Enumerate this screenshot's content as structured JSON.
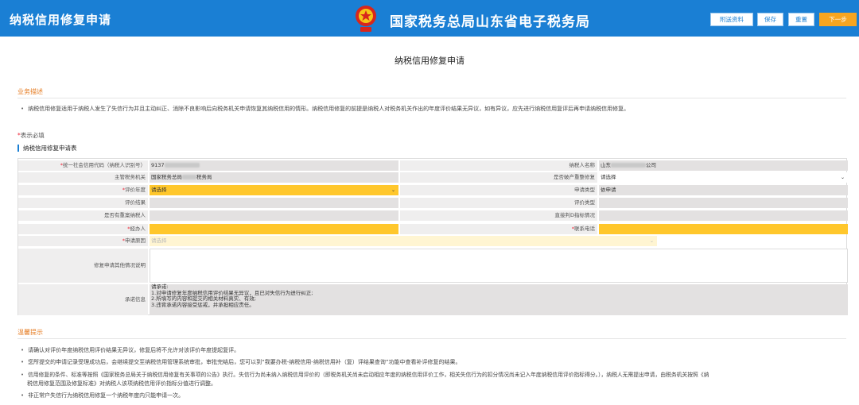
{
  "header": {
    "app_title": "纳税信用修复申请",
    "bureau_name": "国家税务总局山东省电子税务局",
    "buttons": {
      "attachments": "附送资料",
      "save": "保存",
      "reset": "重置",
      "next": "下一步"
    }
  },
  "page_title": "纳税信用修复申请",
  "business_description": {
    "title": "业务描述",
    "text": "纳税信用修复适用于纳税人发生了失信行为并且主动纠正、消除不良影响后向税务机关申请恢复其纳税信用的情形。纳税信用修复的前提是纳税人对税务机关作出的年度评价结果无异议，如有异议，应先进行纳税信用复评后再申请纳税信用修复。"
  },
  "required_note": "表示必填",
  "form": {
    "title": "纳税信用修复申请表",
    "credit_code_label": "统一社会信用代码（纳税人识别号）",
    "credit_code_value": "9137",
    "taxpayer_name_label": "纳税人名称",
    "taxpayer_name_prefix": "山东",
    "taxpayer_name_suffix": "公司",
    "tax_authority_label": "主管税务机关",
    "tax_authority_prefix": "国家税务总局",
    "tax_authority_suffix": "税务局",
    "bankruptcy_label": "是否破产重整修复",
    "bankruptcy_value": "请选择",
    "eval_year_label": "评价年度",
    "eval_year_value": "请选择",
    "apply_type_label": "申请类型",
    "apply_type_value": "依申请",
    "eval_result_label": "评价结果",
    "eval_type_label": "评价类型",
    "major_violation_label": "是否有重案纳税人",
    "direct_d_label": "直接判D指标情况",
    "handler_label": "经办人",
    "contact_phone_label": "联系电话",
    "reason_label": "申请原因",
    "reason_value": "请选择",
    "other_explain_label": "修复申请其他情况说明",
    "promise_label": "承诺信息",
    "promise_text": "请承诺:\n1.对申请修复年度纳税信用评价结果无异议，且已对失信行为进行纠正;\n2.所填写的内容和提交的相关材料真实、有效;\n3.违背承诺内容接受惩戒，并承担相应责任。"
  },
  "tips": {
    "title": "温馨提示",
    "items": [
      "请确认对评价年度纳税信用评价结果无异议，修复后将不允许对该评价年度提起复评。",
      "您所提交的申请记录受理成功后，会继续提交至纳税信用管理系统审批，审批完结后，您可以到“我要办税-纳税信用-纳税信用补（复）评结果查询”功能中查看补评修复的结果。",
      "信用修复的条件、标准等按照《国家税务总局关于纳税信用修复有关事项的公告》执行。失信行为尚未纳入纳税信用评价的（即税务机关尚未启动相应年度的纳税信用评价工作，相关失信行为的扣分情况尚未记入年度纳税信用评价指标得分。），纳税人无需提出申请，由税务机关按照《纳",
      "税信用修复范围及修复标准》对纳税人该项纳税信用评价指标分值进行调整。",
      "非正常户失信行为纳税信用修复一个纳税年度内只能申请一次。"
    ]
  },
  "colors": {
    "header_blue": "#1a7fd4",
    "accent_orange": "#e57b21",
    "required_yellow": "#ffc72c",
    "next_button": "#f7a520"
  }
}
